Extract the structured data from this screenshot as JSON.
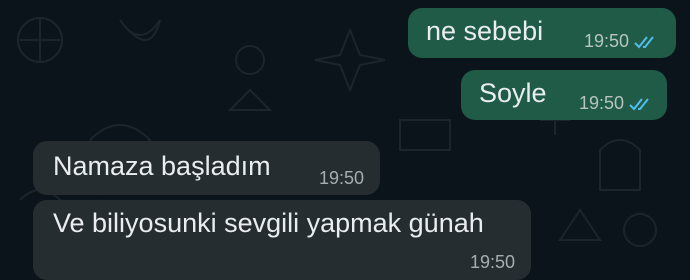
{
  "chat": {
    "messages": [
      {
        "id": "m1",
        "direction": "outgoing",
        "text": "ne sebebi",
        "time": "19:50",
        "status": "read"
      },
      {
        "id": "m2",
        "direction": "outgoing",
        "text": "Soyle",
        "time": "19:50",
        "status": "read"
      },
      {
        "id": "m3",
        "direction": "incoming",
        "text": "Namaza başladım",
        "time": "19:50"
      },
      {
        "id": "m4",
        "direction": "incoming",
        "text": "Ve biliyosunki sevgili yapmak günah",
        "time": "19:50"
      }
    ]
  },
  "icons": {
    "read_receipt": "double-check-icon"
  },
  "colors": {
    "background": "#0b141a",
    "outgoing_bubble": "#1f5b47",
    "incoming_bubble": "#262d31",
    "text": "#e9edef",
    "read_ticks": "#53bdeb"
  }
}
